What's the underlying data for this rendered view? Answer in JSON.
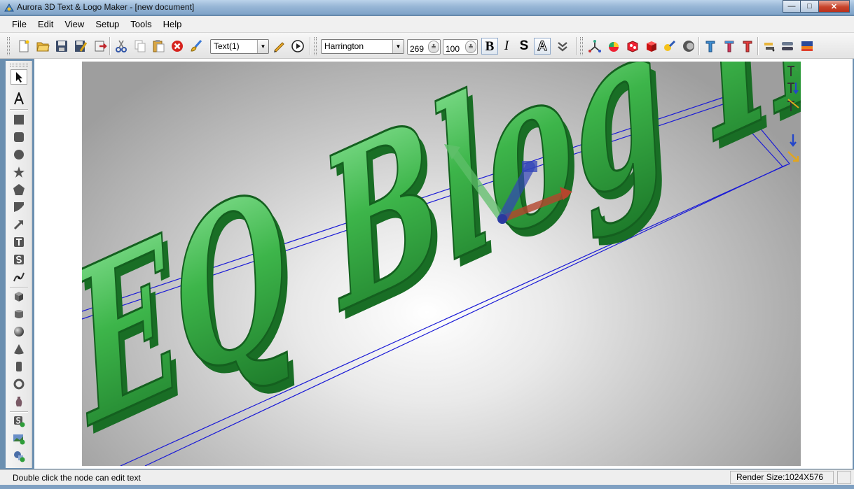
{
  "window": {
    "title": "Aurora 3D Text & Logo Maker - [new document]"
  },
  "menu": [
    "File",
    "Edit",
    "View",
    "Setup",
    "Tools",
    "Help"
  ],
  "toolbar": {
    "object_select": "Text(1)",
    "font": "Harrington",
    "size_value": "269",
    "depth_value": "100",
    "bold_label": "B",
    "italic_label": "I",
    "strike_label": "S",
    "outline_label": "A"
  },
  "scene": {
    "text": "EQ Blog Hijau",
    "text_color": "#3db54a"
  },
  "status": {
    "hint": "Double click the node can edit text",
    "render_size": "Render Size:1024X576"
  }
}
